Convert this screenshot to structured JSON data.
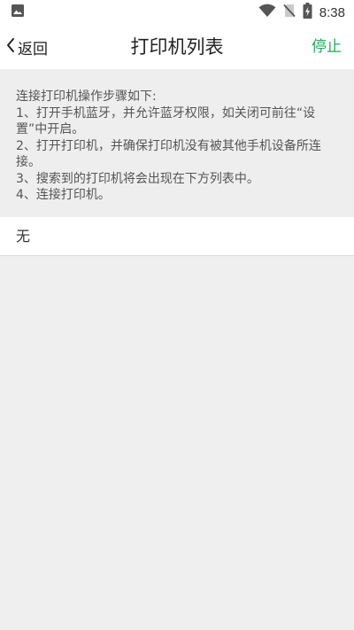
{
  "status_bar": {
    "time": "8:38",
    "icons": [
      "image-icon",
      "wifi-icon",
      "no-sim-icon",
      "battery-charging-icon"
    ]
  },
  "header": {
    "back_label": "返回",
    "title": "打印机列表",
    "stop_label": "停止"
  },
  "instructions": {
    "heading": "连接打印机操作步骤如下:",
    "steps": [
      "1、打开手机蓝牙，并允许蓝牙权限，如关闭可前往“设置”中开启。",
      "2、打开打印机，并确保打印机没有被其他手机设备所连接。",
      "3、搜索到的打印机将会出现在下方列表中。",
      "4、连接打印机。"
    ]
  },
  "device_list": {
    "items": [
      "无"
    ]
  },
  "colors": {
    "accent": "#1aad5b",
    "background": "#efefef",
    "surface": "#ffffff",
    "text": "#222222",
    "muted_text": "#555555"
  }
}
